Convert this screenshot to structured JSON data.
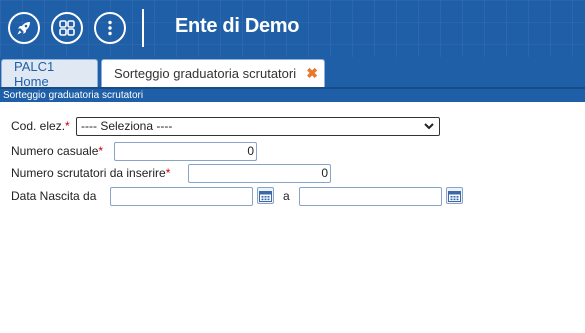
{
  "header": {
    "title": "Ente di Demo",
    "buttons": [
      {
        "icon": "rocket-icon"
      },
      {
        "icon": "grid-icon"
      },
      {
        "icon": "more-vertical-icon"
      }
    ],
    "bg_color": "#1f5fa8"
  },
  "tabs": [
    {
      "label": "PALC1 Home",
      "active": false
    },
    {
      "label": "Sorteggio graduatoria scrutatori",
      "active": true,
      "close": "✖"
    }
  ],
  "subheader": "Sorteggio graduatoria scrutatori",
  "form": {
    "cod_elez": {
      "label": "Cod. elez.",
      "required": "*",
      "selected": "---- Seleziona ----"
    },
    "numero_casuale": {
      "label": "Numero casuale",
      "required": "*",
      "value": "0"
    },
    "numero_scrutatori": {
      "label": "Numero scrutatori da inserire",
      "required": "*",
      "value": "0"
    },
    "data_nascita": {
      "label": "Data Nascita da",
      "from_value": "",
      "to_label": "a",
      "to_value": ""
    }
  }
}
